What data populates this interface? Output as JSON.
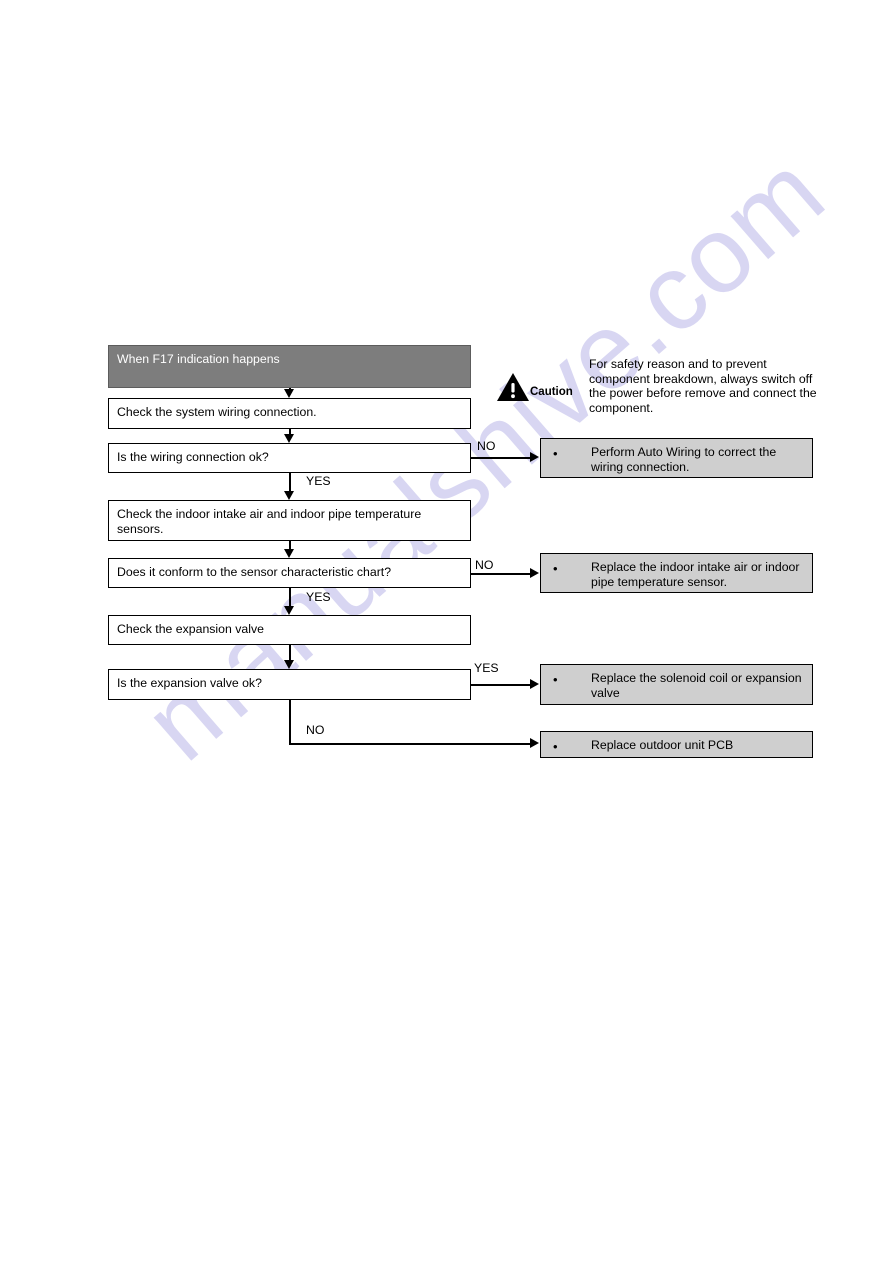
{
  "document": {
    "watermark_text": "manualshive.com"
  },
  "caution": {
    "icon": "warning-triangle-icon",
    "label": "Caution",
    "text": "For safety reason and to prevent component breakdown, always switch off the power before remove and connect the component."
  },
  "colors": {
    "header_fill": "#7d7d7d",
    "header_text": "#ffffff",
    "action_fill": "#cfcfcf",
    "node_fill": "#ffffff",
    "line": "#000000",
    "watermark": "#b9b6e8"
  },
  "chart_data": {
    "type": "diagram",
    "title": "When F17 indication happens",
    "nodes": [
      {
        "id": "start",
        "kind": "header",
        "text": "When F17 indication happens"
      },
      {
        "id": "step1",
        "kind": "process",
        "text": "Check the system wiring connection."
      },
      {
        "id": "dec1",
        "kind": "decision",
        "text": "Is the wiring connection ok?"
      },
      {
        "id": "step2",
        "kind": "process",
        "text": "Check the indoor intake air and indoor pipe temperature sensors."
      },
      {
        "id": "dec2",
        "kind": "decision",
        "text": "Does it conform to the sensor characteristic chart?"
      },
      {
        "id": "step3",
        "kind": "process",
        "text": "Check the expansion valve"
      },
      {
        "id": "dec3",
        "kind": "decision",
        "text": "Is the expansion valve ok?"
      },
      {
        "id": "act1",
        "kind": "action",
        "text": "Perform Auto Wiring to correct the wiring connection."
      },
      {
        "id": "act2",
        "kind": "action",
        "text": "Replace the indoor intake air or indoor pipe temperature sensor."
      },
      {
        "id": "act3",
        "kind": "action",
        "text": "Replace the solenoid coil or expansion valve"
      },
      {
        "id": "act4",
        "kind": "action",
        "text": "Replace outdoor unit PCB"
      }
    ],
    "edges": [
      {
        "from": "start",
        "to": "step1",
        "label": ""
      },
      {
        "from": "step1",
        "to": "dec1",
        "label": ""
      },
      {
        "from": "dec1",
        "to": "act1",
        "label": "NO"
      },
      {
        "from": "dec1",
        "to": "step2",
        "label": "YES"
      },
      {
        "from": "step2",
        "to": "dec2",
        "label": ""
      },
      {
        "from": "dec2",
        "to": "act2",
        "label": "NO"
      },
      {
        "from": "dec2",
        "to": "step3",
        "label": "YES"
      },
      {
        "from": "step3",
        "to": "dec3",
        "label": ""
      },
      {
        "from": "dec3",
        "to": "act3",
        "label": "YES"
      },
      {
        "from": "dec3",
        "to": "act4",
        "label": "NO"
      }
    ],
    "edge_labels": {
      "no1": "NO",
      "yes1": "YES",
      "no2": "NO",
      "yes2": "YES",
      "yes3": "YES",
      "no3": "NO"
    },
    "bullet": "•"
  }
}
